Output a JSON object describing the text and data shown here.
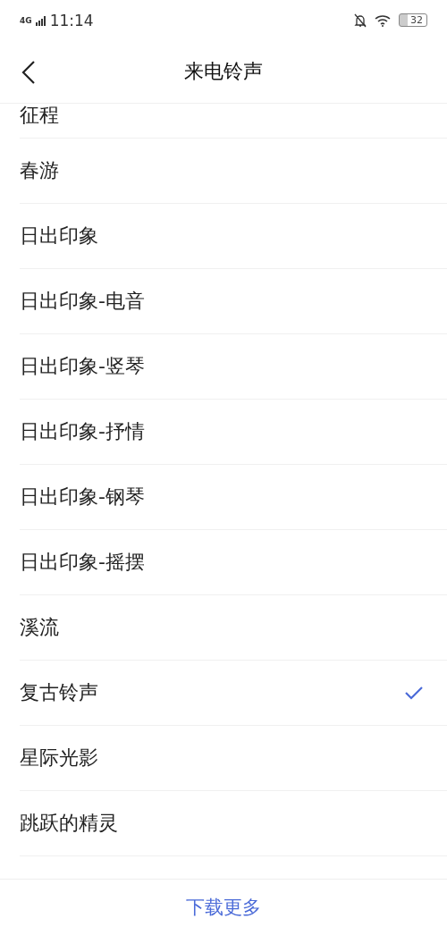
{
  "status_bar": {
    "network": "4G",
    "time": "11:14",
    "battery": "32"
  },
  "header": {
    "title": "来电铃声"
  },
  "ringtones": [
    {
      "name": "征程",
      "selected": false
    },
    {
      "name": "春游",
      "selected": false
    },
    {
      "name": "日出印象",
      "selected": false
    },
    {
      "name": "日出印象-电音",
      "selected": false
    },
    {
      "name": "日出印象-竖琴",
      "selected": false
    },
    {
      "name": "日出印象-抒情",
      "selected": false
    },
    {
      "name": "日出印象-钢琴",
      "selected": false
    },
    {
      "name": "日出印象-摇摆",
      "selected": false
    },
    {
      "name": "溪流",
      "selected": false
    },
    {
      "name": "复古铃声",
      "selected": true
    },
    {
      "name": "星际光影",
      "selected": false
    },
    {
      "name": "跳跃的精灵",
      "selected": false
    }
  ],
  "footer": {
    "action": "下载更多"
  }
}
